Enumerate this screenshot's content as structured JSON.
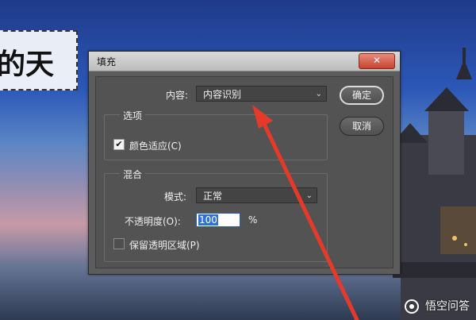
{
  "background": {
    "text_fragment": "的天"
  },
  "dialog": {
    "title": "填充",
    "close_label": "✕",
    "contents_label": "内容:",
    "contents_value": "内容识别",
    "options_group": "选项",
    "color_adapt_label": "颜色适应(C)",
    "color_adapt_checked": true,
    "blend_group": "混合",
    "mode_label": "模式:",
    "mode_value": "正常",
    "opacity_label": "不透明度(O):",
    "opacity_value": "100",
    "opacity_unit": "%",
    "preserve_transparency_label": "保留透明区域(P)",
    "preserve_transparency_checked": false,
    "ok_label": "确定",
    "cancel_label": "取消"
  },
  "watermark": {
    "text": "悟空问答"
  },
  "colors": {
    "dialog_bg": "#5c5c5c",
    "arrow": "#e53a2a",
    "close_button": "#c7432f",
    "selection": "#2f6fd6"
  }
}
